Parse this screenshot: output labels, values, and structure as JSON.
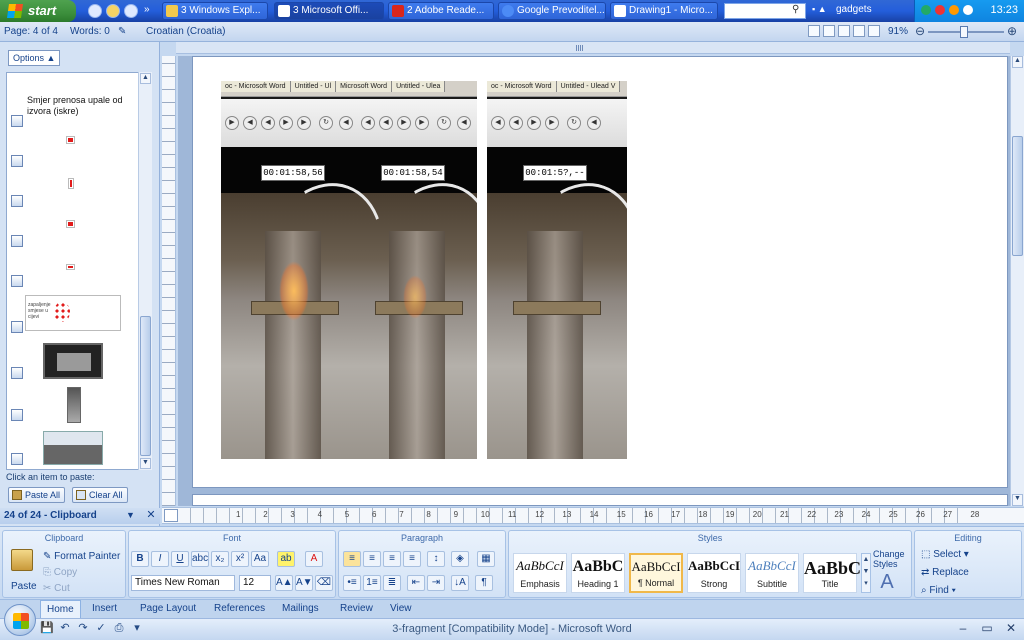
{
  "taskbar": {
    "start_label": "start",
    "tasks": [
      {
        "label": "3 Windows Expl...",
        "color": "#f2c94c"
      },
      {
        "label": "3 Microsoft Offi...",
        "color": "#ffffff"
      },
      {
        "label": "2 Adobe Reade...",
        "color": "#d9261c"
      },
      {
        "label": "Google Prevoditel...",
        "color": "#4c8bf5"
      },
      {
        "label": "Drawing1 - Micro...",
        "color": "#ffffff"
      }
    ],
    "gadgets_label": "gadgets",
    "clock": "13:23"
  },
  "statusbar": {
    "page": "Page: 4 of 4",
    "words": "Words: 0",
    "language": "Croatian (Croatia)",
    "zoom": "91%"
  },
  "clipboard": {
    "title": "24 of 24 - Clipboard",
    "options_label": "Options",
    "hint": "Click an item to paste:",
    "paste_all": "Paste All",
    "clear_all": "Clear All",
    "text_item": "Smjer prenosa upale od izvora (iskre)",
    "note_text": "zapaljenje smjese u cijevi"
  },
  "document": {
    "shots": [
      {
        "tabs": [
          "oc - Microsoft Word",
          "Untitled - Ul"
        ],
        "time": "00:01:58,56"
      },
      {
        "tabs": [
          "Microsoft Word",
          "Untitled - Ulea"
        ],
        "time": "00:01:58,54"
      },
      {
        "tabs": [
          "oc - Microsoft Word",
          "Untitled - Ulead V"
        ],
        "time": "00:01:5?,--"
      }
    ],
    "ruler_numbers": [
      "1",
      "2",
      "3",
      "4",
      "5",
      "6",
      "7",
      "8",
      "9",
      "10",
      "11",
      "12",
      "13",
      "14",
      "15",
      "16",
      "17",
      "18",
      "19",
      "20",
      "21",
      "22",
      "23",
      "24",
      "25",
      "26",
      "27",
      "28"
    ]
  },
  "ribbon": {
    "clipboard_group": "Clipboard",
    "paste": "Paste",
    "cut": "Cut",
    "copy": "Copy",
    "format_painter": "Format Painter",
    "font_group": "Font",
    "font_name": "Times New Roman",
    "font_size": "12",
    "paragraph_group": "Paragraph",
    "styles_group": "Styles",
    "styles": [
      {
        "sample": "AaBbCcI",
        "name": "Emphasis"
      },
      {
        "sample": "AaBbC",
        "name": "Heading 1"
      },
      {
        "sample": "AaBbCcI",
        "name": "¶ Normal"
      },
      {
        "sample": "AaBbCcI",
        "name": "Strong"
      },
      {
        "sample": "AaBbCcI",
        "name": "Subtitle"
      },
      {
        "sample": "AaBbC",
        "name": "Title"
      }
    ],
    "change_styles": "Change Styles",
    "editing_group": "Editing",
    "find": "Find",
    "replace": "Replace",
    "select": "Select"
  },
  "ribbon_tabs": [
    "Home",
    "Insert",
    "Page Layout",
    "References",
    "Mailings",
    "Review",
    "View"
  ],
  "title": "3-fragment [Compatibility Mode] - Microsoft Word"
}
